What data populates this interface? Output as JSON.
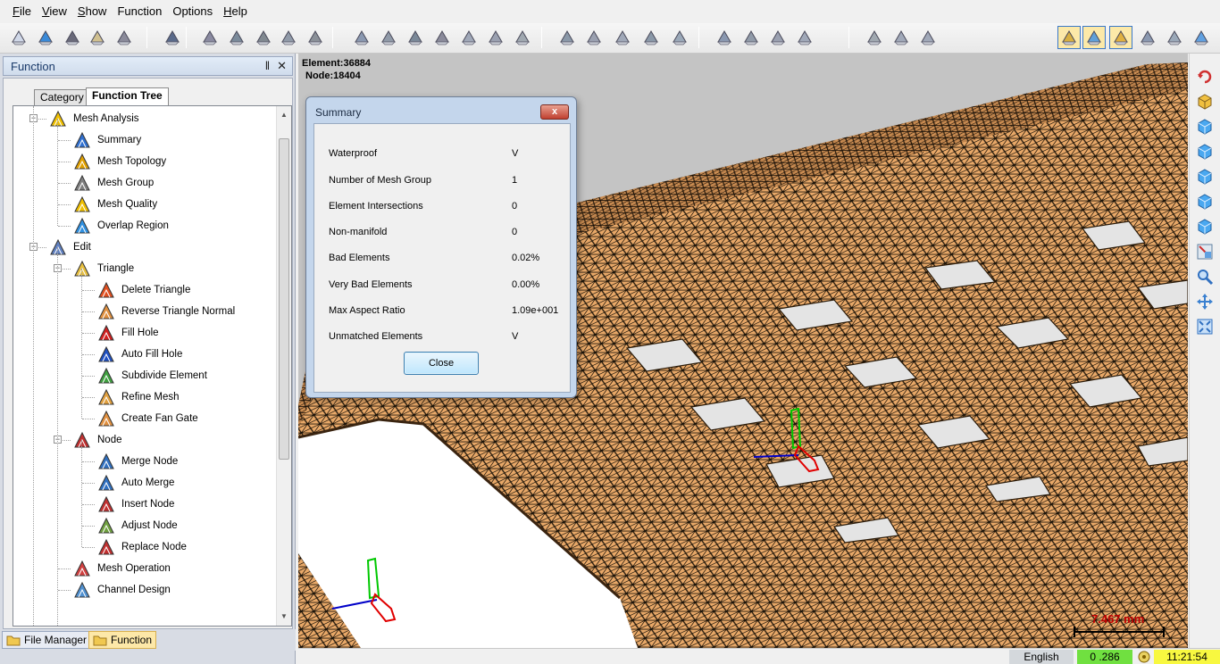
{
  "menubar": {
    "items": [
      {
        "first": "F",
        "rest": "ile"
      },
      {
        "first": "V",
        "rest": "iew"
      },
      {
        "first": "S",
        "rest": "how"
      },
      {
        "first": "",
        "rest": "Function"
      },
      {
        "first": "",
        "rest": "Options"
      },
      {
        "first": "H",
        "rest": "elp"
      }
    ]
  },
  "panel": {
    "title": "Function",
    "pin_glyph": "‖",
    "close_glyph": "✕",
    "tabs": [
      "Category",
      "Function Tree"
    ]
  },
  "tree": {
    "items": [
      {
        "label": "Mesh Analysis",
        "icon": "mesh-analysis-icon"
      },
      {
        "label": "Summary",
        "icon": "summary-icon"
      },
      {
        "label": "Mesh Topology",
        "icon": "mesh-topology-icon"
      },
      {
        "label": "Mesh Group",
        "icon": "mesh-group-icon"
      },
      {
        "label": "Mesh Quality",
        "icon": "mesh-quality-icon"
      },
      {
        "label": "Overlap Region",
        "icon": "overlap-region-icon"
      },
      {
        "label": "Edit",
        "icon": "edit-pen-icon"
      },
      {
        "label": "Triangle",
        "icon": "triangle-icon"
      },
      {
        "label": "Delete Triangle",
        "icon": "delete-triangle-icon"
      },
      {
        "label": "Reverse Triangle Normal",
        "icon": "reverse-normal-icon"
      },
      {
        "label": "Fill Hole",
        "icon": "fill-hole-icon"
      },
      {
        "label": "Auto Fill Hole",
        "icon": "auto-fill-hole-icon"
      },
      {
        "label": "Subdivide Element",
        "icon": "subdivide-element-icon"
      },
      {
        "label": "Refine Mesh",
        "icon": "refine-mesh-icon"
      },
      {
        "label": "Create Fan Gate",
        "icon": "fan-gate-icon"
      },
      {
        "label": "Node",
        "icon": "node-icon"
      },
      {
        "label": "Merge Node",
        "icon": "merge-node-icon"
      },
      {
        "label": "Auto Merge",
        "icon": "auto-merge-icon"
      },
      {
        "label": "Insert Node",
        "icon": "insert-node-icon"
      },
      {
        "label": "Adjust Node",
        "icon": "adjust-node-icon"
      },
      {
        "label": "Replace Node",
        "icon": "replace-node-icon"
      },
      {
        "label": "Mesh Operation",
        "icon": "mesh-operation-icon"
      },
      {
        "label": "Channel Design",
        "icon": "channel-design-icon"
      }
    ]
  },
  "bottom_tabs": {
    "file_manager": "File Manager",
    "function": "Function"
  },
  "viewport": {
    "element_count": "Element:36884",
    "node_count": "Node:18404",
    "scale_label": "7.467 mm",
    "mesh_color": "#e8a868",
    "wire_color": "#1a1208"
  },
  "summary_dialog": {
    "title": "Summary",
    "rows": [
      {
        "label": "Waterproof",
        "value": "V"
      },
      {
        "label": "Number of Mesh Group",
        "value": "1"
      },
      {
        "label": "Element Intersections",
        "value": "0"
      },
      {
        "label": "Non-manifold",
        "value": "0"
      },
      {
        "label": "Bad Elements",
        "value": "0.02%"
      },
      {
        "label": "Very Bad Elements",
        "value": "0.00%"
      },
      {
        "label": "Max Aspect Ratio",
        "value": "1.09e+001"
      },
      {
        "label": "Unmatched Elements",
        "value": "V"
      }
    ],
    "close_label": "Close",
    "close_glyph": "x"
  },
  "statusbar": {
    "language": "English",
    "value": "0 .286",
    "time": "11:21:54"
  },
  "icons": {
    "toolbar": [
      "new-file-icon",
      "import-icon",
      "save-icon",
      "open-folder-icon",
      "tree-list-icon",
      "undo-icon",
      "mesh-view-icon",
      "topology-icon",
      "visibility-eye-icon",
      "mesh-check-icon",
      "camera-icon",
      "delete-element-icon",
      "reverse-icon",
      "fill-icon",
      "auto-fill-icon",
      "subdivide-icon",
      "refine-icon",
      "fan-gate-icon",
      "merge-icon",
      "auto-merge-icon",
      "insert-icon",
      "adjust-icon",
      "replace-icon",
      "operation-icon",
      "channel-icon",
      "extrude-icon",
      "ruler-icon",
      "grid-icon",
      "gate-icon",
      "box-icon",
      "shaded-cube-icon",
      "wire-cube-icon",
      "solid-view-icon",
      "gear-cube-icon",
      "cube-icon",
      "more-cube-icon"
    ],
    "right_bar": [
      "rotate-icon",
      "iso-view-icon",
      "front-view-icon",
      "back-view-icon",
      "top-view-icon",
      "bottom-view-icon",
      "side-view-icon",
      "fit-view-icon",
      "zoom-icon",
      "pan-icon",
      "fit-all-icon"
    ]
  }
}
